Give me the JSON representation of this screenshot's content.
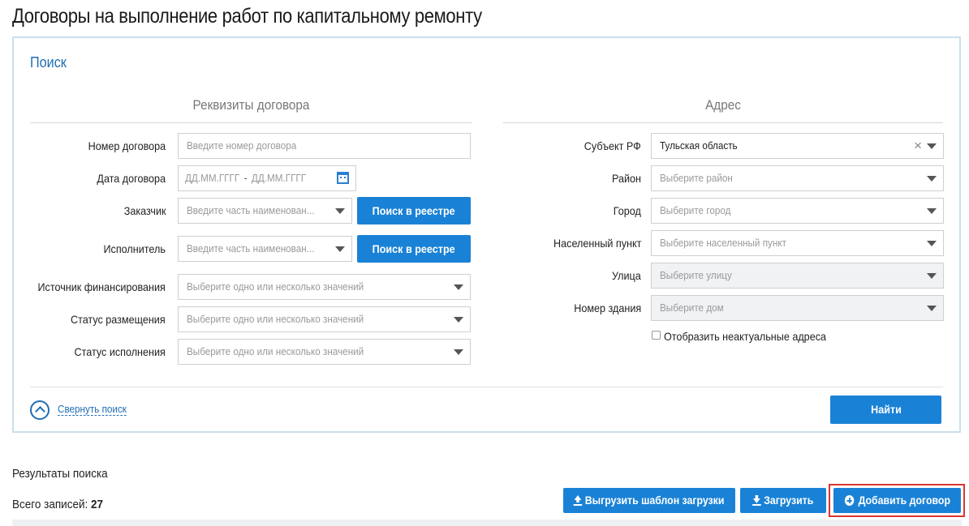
{
  "page": {
    "title": "Договоры на выполнение работ по капитальному ремонту"
  },
  "search": {
    "title": "Поиск",
    "requisites_title": "Реквизиты договора",
    "address_title": "Адрес",
    "fields": {
      "contract_number": {
        "label": "Номер договора",
        "placeholder": "Введите номер договора"
      },
      "contract_date": {
        "label": "Дата договора",
        "from_placeholder": "ДД.ММ.ГГГГ",
        "separator": "-",
        "to_placeholder": "ДД.ММ.ГГГГ"
      },
      "customer": {
        "label": "Заказчик",
        "placeholder": "Введите часть наименован...",
        "button": "Поиск в реестре"
      },
      "contractor": {
        "label": "Исполнитель",
        "placeholder": "Введите часть наименован...",
        "button": "Поиск в реестре"
      },
      "funding_source": {
        "label": "Источник финансирования",
        "placeholder": "Выберите одно или несколько значений"
      },
      "placement_status": {
        "label": "Статус размещения",
        "placeholder": "Выберите одно или несколько значений"
      },
      "execution_status": {
        "label": "Статус исполнения",
        "placeholder": "Выберите одно или несколько значений"
      }
    },
    "address": {
      "subject": {
        "label": "Субъект РФ",
        "value": "Тульская область"
      },
      "district": {
        "label": "Район",
        "placeholder": "Выберите район"
      },
      "city": {
        "label": "Город",
        "placeholder": "Выберите город"
      },
      "settlement": {
        "label": "Населенный пункт",
        "placeholder": "Выберите населенный пункт"
      },
      "street": {
        "label": "Улица",
        "placeholder": "Выберите улицу"
      },
      "building": {
        "label": "Номер здания",
        "placeholder": "Выберите дом"
      },
      "show_inactive": {
        "label": "Отобразить неактуальные адреса",
        "checked": false
      }
    },
    "collapse_label": "Свернуть поиск",
    "find_button": "Найти"
  },
  "results": {
    "title": "Результаты поиска",
    "total_label": "Всего записей:",
    "total_value": "27",
    "export_template_button": "Выгрузить шаблон загрузки",
    "upload_button": "Загрузить",
    "add_contract_button": "Добавить договор"
  },
  "colors": {
    "accent": "#1a82d6",
    "title_blue": "#1f6eb5",
    "panel_border": "#c9e0ec",
    "highlight": "#d9362e"
  },
  "icons": [
    "calendar-icon",
    "chevron-down-icon",
    "clear-icon",
    "collapse-icon",
    "upload-icon",
    "download-icon",
    "plus-circle-icon"
  ]
}
